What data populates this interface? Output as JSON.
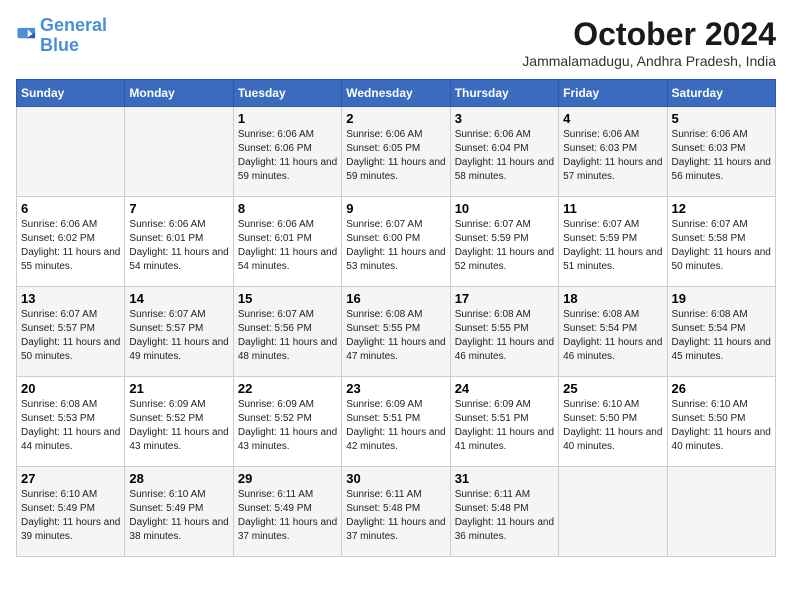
{
  "logo": {
    "line1": "General",
    "line2": "Blue"
  },
  "title": "October 2024",
  "subtitle": "Jammalamadugu, Andhra Pradesh, India",
  "days_header": [
    "Sunday",
    "Monday",
    "Tuesday",
    "Wednesday",
    "Thursday",
    "Friday",
    "Saturday"
  ],
  "weeks": [
    [
      {
        "day": "",
        "info": ""
      },
      {
        "day": "",
        "info": ""
      },
      {
        "day": "1",
        "info": "Sunrise: 6:06 AM\nSunset: 6:06 PM\nDaylight: 11 hours and 59 minutes."
      },
      {
        "day": "2",
        "info": "Sunrise: 6:06 AM\nSunset: 6:05 PM\nDaylight: 11 hours and 59 minutes."
      },
      {
        "day": "3",
        "info": "Sunrise: 6:06 AM\nSunset: 6:04 PM\nDaylight: 11 hours and 58 minutes."
      },
      {
        "day": "4",
        "info": "Sunrise: 6:06 AM\nSunset: 6:03 PM\nDaylight: 11 hours and 57 minutes."
      },
      {
        "day": "5",
        "info": "Sunrise: 6:06 AM\nSunset: 6:03 PM\nDaylight: 11 hours and 56 minutes."
      }
    ],
    [
      {
        "day": "6",
        "info": "Sunrise: 6:06 AM\nSunset: 6:02 PM\nDaylight: 11 hours and 55 minutes."
      },
      {
        "day": "7",
        "info": "Sunrise: 6:06 AM\nSunset: 6:01 PM\nDaylight: 11 hours and 54 minutes."
      },
      {
        "day": "8",
        "info": "Sunrise: 6:06 AM\nSunset: 6:01 PM\nDaylight: 11 hours and 54 minutes."
      },
      {
        "day": "9",
        "info": "Sunrise: 6:07 AM\nSunset: 6:00 PM\nDaylight: 11 hours and 53 minutes."
      },
      {
        "day": "10",
        "info": "Sunrise: 6:07 AM\nSunset: 5:59 PM\nDaylight: 11 hours and 52 minutes."
      },
      {
        "day": "11",
        "info": "Sunrise: 6:07 AM\nSunset: 5:59 PM\nDaylight: 11 hours and 51 minutes."
      },
      {
        "day": "12",
        "info": "Sunrise: 6:07 AM\nSunset: 5:58 PM\nDaylight: 11 hours and 50 minutes."
      }
    ],
    [
      {
        "day": "13",
        "info": "Sunrise: 6:07 AM\nSunset: 5:57 PM\nDaylight: 11 hours and 50 minutes."
      },
      {
        "day": "14",
        "info": "Sunrise: 6:07 AM\nSunset: 5:57 PM\nDaylight: 11 hours and 49 minutes."
      },
      {
        "day": "15",
        "info": "Sunrise: 6:07 AM\nSunset: 5:56 PM\nDaylight: 11 hours and 48 minutes."
      },
      {
        "day": "16",
        "info": "Sunrise: 6:08 AM\nSunset: 5:55 PM\nDaylight: 11 hours and 47 minutes."
      },
      {
        "day": "17",
        "info": "Sunrise: 6:08 AM\nSunset: 5:55 PM\nDaylight: 11 hours and 46 minutes."
      },
      {
        "day": "18",
        "info": "Sunrise: 6:08 AM\nSunset: 5:54 PM\nDaylight: 11 hours and 46 minutes."
      },
      {
        "day": "19",
        "info": "Sunrise: 6:08 AM\nSunset: 5:54 PM\nDaylight: 11 hours and 45 minutes."
      }
    ],
    [
      {
        "day": "20",
        "info": "Sunrise: 6:08 AM\nSunset: 5:53 PM\nDaylight: 11 hours and 44 minutes."
      },
      {
        "day": "21",
        "info": "Sunrise: 6:09 AM\nSunset: 5:52 PM\nDaylight: 11 hours and 43 minutes."
      },
      {
        "day": "22",
        "info": "Sunrise: 6:09 AM\nSunset: 5:52 PM\nDaylight: 11 hours and 43 minutes."
      },
      {
        "day": "23",
        "info": "Sunrise: 6:09 AM\nSunset: 5:51 PM\nDaylight: 11 hours and 42 minutes."
      },
      {
        "day": "24",
        "info": "Sunrise: 6:09 AM\nSunset: 5:51 PM\nDaylight: 11 hours and 41 minutes."
      },
      {
        "day": "25",
        "info": "Sunrise: 6:10 AM\nSunset: 5:50 PM\nDaylight: 11 hours and 40 minutes."
      },
      {
        "day": "26",
        "info": "Sunrise: 6:10 AM\nSunset: 5:50 PM\nDaylight: 11 hours and 40 minutes."
      }
    ],
    [
      {
        "day": "27",
        "info": "Sunrise: 6:10 AM\nSunset: 5:49 PM\nDaylight: 11 hours and 39 minutes."
      },
      {
        "day": "28",
        "info": "Sunrise: 6:10 AM\nSunset: 5:49 PM\nDaylight: 11 hours and 38 minutes."
      },
      {
        "day": "29",
        "info": "Sunrise: 6:11 AM\nSunset: 5:49 PM\nDaylight: 11 hours and 37 minutes."
      },
      {
        "day": "30",
        "info": "Sunrise: 6:11 AM\nSunset: 5:48 PM\nDaylight: 11 hours and 37 minutes."
      },
      {
        "day": "31",
        "info": "Sunrise: 6:11 AM\nSunset: 5:48 PM\nDaylight: 11 hours and 36 minutes."
      },
      {
        "day": "",
        "info": ""
      },
      {
        "day": "",
        "info": ""
      }
    ]
  ]
}
